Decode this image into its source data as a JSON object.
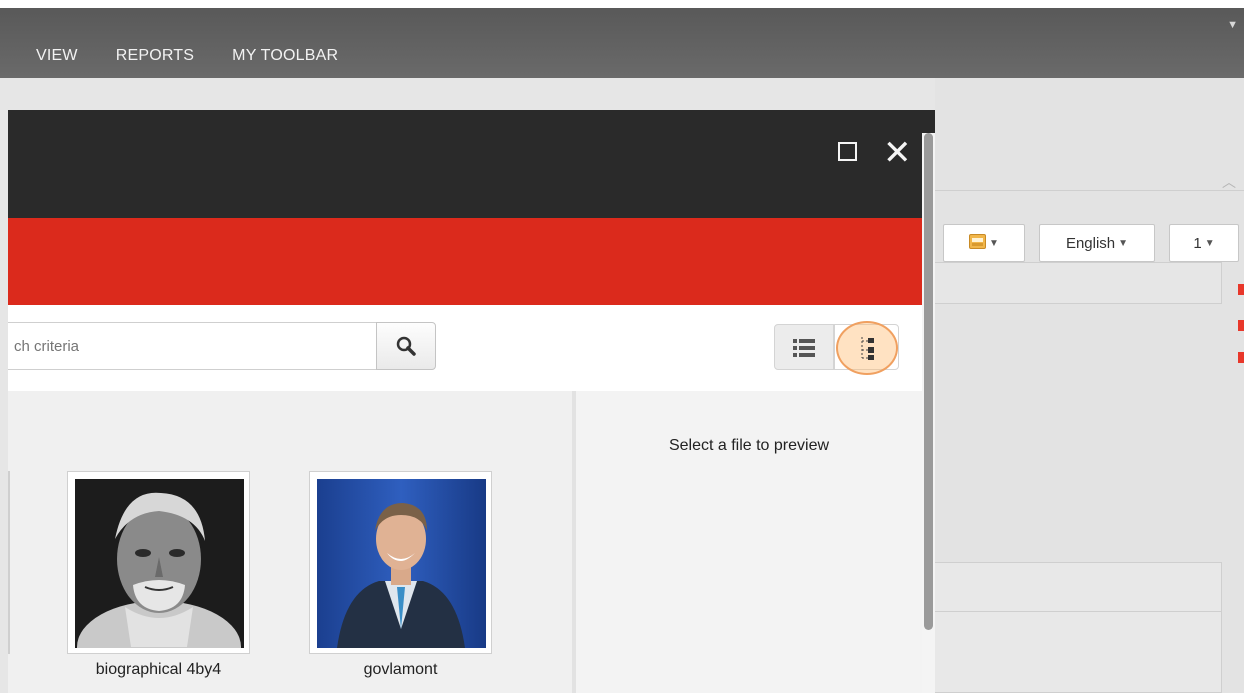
{
  "menu": {
    "items": [
      "VIEW",
      "REPORTS",
      "MY TOOLBAR"
    ]
  },
  "background_panel": {
    "language_dropdown": "English",
    "page_dropdown": "1"
  },
  "dialog": {
    "search": {
      "placeholder": "ch criteria"
    },
    "preview": {
      "message": "Select a file to preview"
    },
    "files": [
      {
        "name": "biographical 4by4"
      },
      {
        "name": "govlamont"
      }
    ],
    "icons": {
      "maximize": "maximize-icon",
      "close": "close-icon",
      "search": "search-icon",
      "list_view": "list-view-icon",
      "tree_view": "tree-view-icon"
    }
  },
  "colors": {
    "menu_bar": "#616161",
    "dialog_header": "#2a2a2a",
    "accent_red": "#db2a1c",
    "highlight": "#f0a060"
  }
}
